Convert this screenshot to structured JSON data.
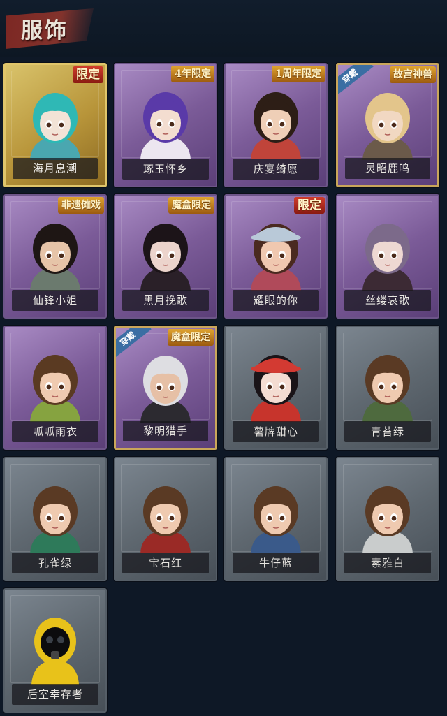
{
  "page": {
    "title": "服饰"
  },
  "costumes": [
    {
      "name": "海月息潮",
      "badge": "限定",
      "frame": "gold",
      "hair": "#2fb8b5",
      "skin": "#f2e3d6",
      "outfit": "#4aa7b0",
      "wearing": false
    },
    {
      "name": "琢玉怀乡",
      "badge": "4年限定",
      "frame": "purple",
      "hair": "#5a3aa8",
      "skin": "#f3ddd0",
      "outfit": "#ece6f0",
      "wearing": false
    },
    {
      "name": "庆宴绮愿",
      "badge": "1周年限定",
      "frame": "purple",
      "hair": "#2d1e16",
      "skin": "#efcfb7",
      "outfit": "#c0443a",
      "wearing": false
    },
    {
      "name": "灵昭鹿鸣",
      "badge": "故宫神兽",
      "frame": "purple",
      "hair": "#e3c58b",
      "skin": "#f1d8c2",
      "outfit": "#6b5a4a",
      "wearing": true,
      "wearing_label": "穿戴"
    },
    {
      "name": "仙锋小姐",
      "badge": "非遗傩戏",
      "frame": "purple",
      "hair": "#1e1614",
      "skin": "#e6c4a8",
      "outfit": "#6b7a6e",
      "wearing": false
    },
    {
      "name": "黑月挽歌",
      "badge": "魔盒限定",
      "frame": "purple",
      "hair": "#1c1418",
      "skin": "#ecd4cc",
      "outfit": "#2a2028",
      "wearing": false
    },
    {
      "name": "耀眼的你",
      "badge": "限定",
      "frame": "purple",
      "hair": "#4a2a20",
      "skin": "#f0c8b0",
      "outfit": "#b04a5a",
      "wearing": false,
      "hat": "#b9c9d8"
    },
    {
      "name": "丝缕哀歌",
      "badge": "",
      "frame": "purple",
      "hair": "#7c6a8a",
      "skin": "#eed8d2",
      "outfit": "#3c2a34",
      "wearing": false
    },
    {
      "name": "呱呱雨衣",
      "badge": "",
      "frame": "purple",
      "hair": "#5a3a22",
      "skin": "#efcab0",
      "outfit": "#86a340",
      "wearing": false
    },
    {
      "name": "黎明猎手",
      "badge": "魔盒限定",
      "frame": "purple",
      "hair": "#dedee2",
      "skin": "#e6c0a6",
      "outfit": "#2c2a30",
      "wearing": true,
      "wearing_label": "穿戴"
    },
    {
      "name": "薯牌甜心",
      "badge": "",
      "frame": "gray",
      "hair": "#1a1418",
      "skin": "#f4dcd2",
      "outfit": "#c7342c",
      "wearing": false,
      "hat": "#d33a32"
    },
    {
      "name": "青苔绿",
      "badge": "",
      "frame": "gray",
      "hair": "#5a3a24",
      "skin": "#efcab0",
      "outfit": "#4e6a3e",
      "wearing": false
    },
    {
      "name": "孔雀绿",
      "badge": "",
      "frame": "gray",
      "hair": "#5a3a24",
      "skin": "#efcab0",
      "outfit": "#2e7a5a",
      "wearing": false
    },
    {
      "name": "宝石红",
      "badge": "",
      "frame": "gray",
      "hair": "#5a3a24",
      "skin": "#efcab0",
      "outfit": "#9a2a26",
      "wearing": false
    },
    {
      "name": "牛仔蓝",
      "badge": "",
      "frame": "gray",
      "hair": "#5a3a24",
      "skin": "#efcab0",
      "outfit": "#3a5a8a",
      "wearing": false
    },
    {
      "name": "素雅白",
      "badge": "",
      "frame": "gray",
      "hair": "#5a3a24",
      "skin": "#efcab0",
      "outfit": "#c9cccc",
      "wearing": false
    },
    {
      "name": "后室幸存者",
      "badge": "",
      "frame": "gray",
      "hair": "#111111",
      "skin": "#222222",
      "outfit": "#e8c21a",
      "wearing": false,
      "hazmat": true
    }
  ]
}
